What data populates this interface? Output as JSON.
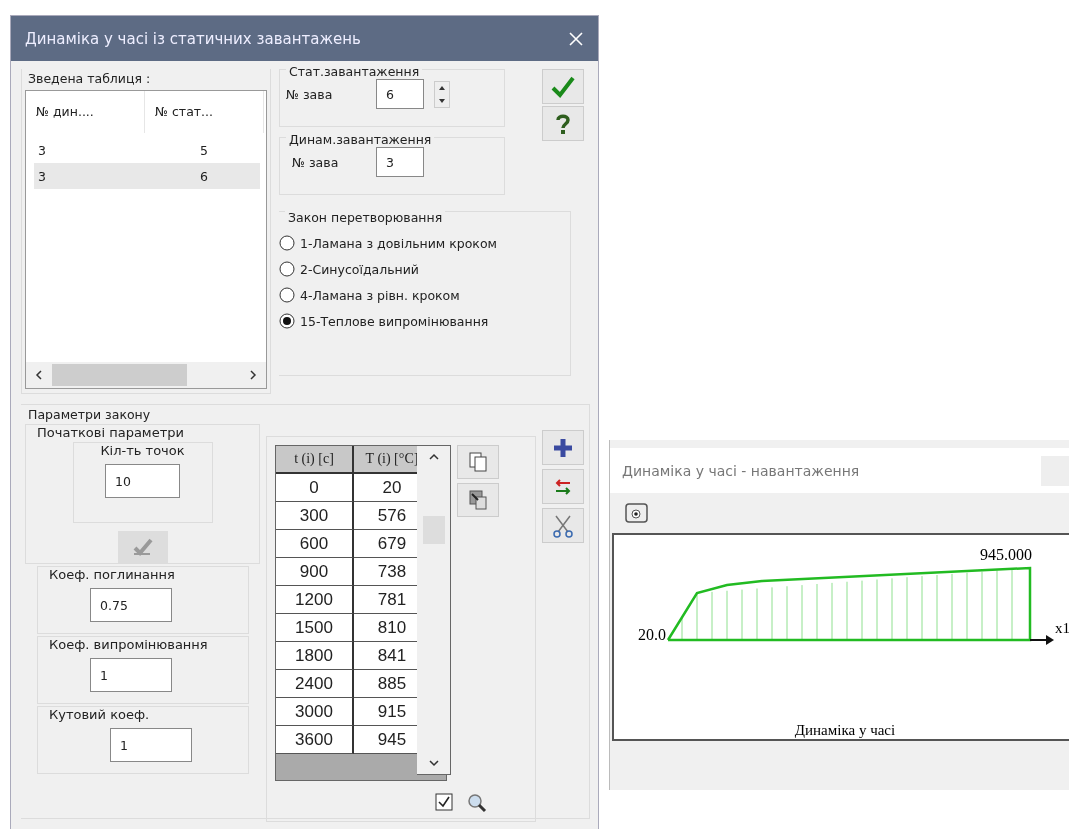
{
  "dialog": {
    "title": "Динаміка у часі із статичних завантажень"
  },
  "summary_table": {
    "label": "Зведена таблиця :",
    "columns": [
      "№ дин....",
      "№ стат..."
    ],
    "rows": [
      {
        "cells": [
          "3",
          "5"
        ],
        "selected": false
      },
      {
        "cells": [
          "3",
          "6"
        ],
        "selected": true
      }
    ]
  },
  "stat_load": {
    "label": "Стат.завантаження",
    "field_label": "№ зава",
    "value": "6"
  },
  "dyn_load": {
    "label": "Динам.завантаження",
    "field_label": "№ зава",
    "value": "3"
  },
  "law": {
    "label": "Закон перетворювання",
    "options": [
      {
        "label": "1-Ламана з довільним кроком",
        "selected": false
      },
      {
        "label": "2-Синусоїдальний",
        "selected": false
      },
      {
        "label": "4-Ламана з рівн. кроком",
        "selected": false
      },
      {
        "label": "15-Теплове випромінювання",
        "selected": true
      }
    ]
  },
  "params": {
    "label": "Параметри закону",
    "initial_label": "Початкові параметри",
    "count_label": "Кіл-ть точок",
    "count_value": "10",
    "fields": [
      {
        "label": "Коеф. поглинання",
        "value": "0.75"
      },
      {
        "label": "Коеф. випромінювання",
        "value": "1"
      },
      {
        "label": "Кутовий коеф.",
        "value": "1"
      }
    ]
  },
  "points_table": {
    "columns": [
      "t (i) [c]",
      "T (i) [°C]"
    ],
    "rows": [
      [
        "0",
        "20"
      ],
      [
        "300",
        "576"
      ],
      [
        "600",
        "679"
      ],
      [
        "900",
        "738"
      ],
      [
        "1200",
        "781"
      ],
      [
        "1500",
        "810"
      ],
      [
        "1800",
        "841"
      ],
      [
        "2400",
        "885"
      ],
      [
        "3000",
        "915"
      ],
      [
        "3600",
        "945"
      ]
    ]
  },
  "show_check": {
    "checked": true
  },
  "graph_window": {
    "title": "Динаміка у часі - навантаження",
    "max_label": "945.000",
    "min_label": "20.0",
    "axis_label": "x1",
    "caption": "Динаміка у часі"
  }
}
